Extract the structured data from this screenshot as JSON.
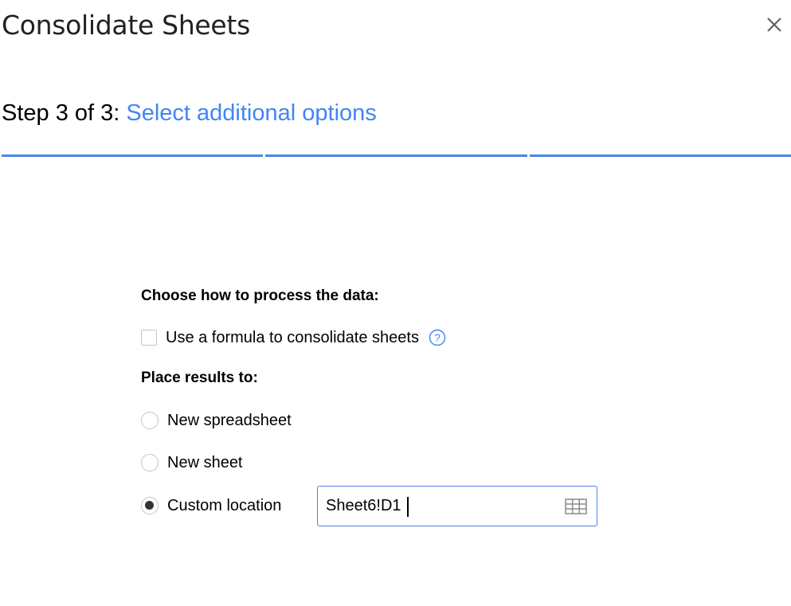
{
  "dialog": {
    "title": "Consolidate Sheets",
    "close_icon": "close-icon"
  },
  "step": {
    "prefix": "Step 3 of 3: ",
    "name": "Select additional options",
    "current": 3,
    "total": 3
  },
  "progress": {
    "segments": 3,
    "completed": 3,
    "color": "#4a86e8"
  },
  "processing": {
    "label": "Choose how to process the data:",
    "formula_option": {
      "label": "Use a formula to consolidate sheets",
      "checked": false,
      "help_icon": "question-circle-icon"
    }
  },
  "placement": {
    "label": "Place results to:",
    "options": [
      {
        "label": "New spreadsheet",
        "selected": false
      },
      {
        "label": "New sheet",
        "selected": false
      },
      {
        "label": "Custom location",
        "selected": true
      }
    ],
    "custom_location_value": "Sheet6!D1",
    "range_picker_icon": "grid-icon"
  },
  "colors": {
    "accent": "#4285f4",
    "border": "#c4c4c4",
    "text": "#000000",
    "title": "#202124"
  }
}
